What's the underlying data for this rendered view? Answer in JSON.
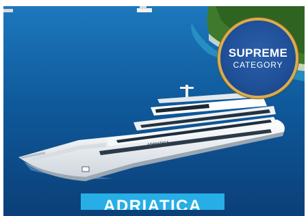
{
  "badge": {
    "title": "SUPREME",
    "subtitle": "CATEGORY",
    "colors": {
      "fill": "#1f4f97",
      "ring": "#d9ad4e"
    }
  },
  "ship_name_label": "ADRIATICA",
  "hull_lettering": "ADRIATICA",
  "colors": {
    "sea": "#0f5a9c",
    "land": "#3f7a2c",
    "label_bg": "#27aee6"
  }
}
